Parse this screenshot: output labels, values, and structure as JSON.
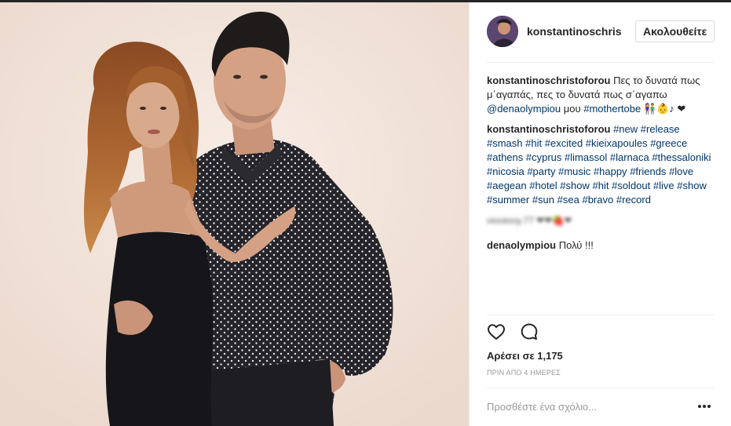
{
  "post": {
    "author": "konstantinoschristoforou",
    "author_short": "konstantinoschristo",
    "follow_label": "Ακολουθείτε"
  },
  "comments": [
    {
      "author": "konstantinoschristoforou",
      "text_before": " Πες το δυνατά πως μ΄αγαπάς, πες το δυνατά πως σ΄αγαπω ",
      "mention": "@denaolympiou",
      "text_mid": " μου ",
      "hashtag": "#mothertobe",
      "emoji": " 👫👶♪ ❤"
    },
    {
      "author": "konstantinoschristoforou",
      "hashtags": [
        "#new",
        "#release",
        "#smash",
        "#hit",
        "#excited",
        "#kieixapoules",
        "#greece",
        "#athens",
        "#cyprus",
        "#limassol",
        "#larnaca",
        "#thessaloniki",
        "#nicosia",
        "#party",
        "#music",
        "#happy",
        "#friends",
        "#love",
        "#aegean",
        "#hotel",
        "#show",
        "#hit",
        "#soldout",
        "#live",
        "#show",
        "#summer",
        "#sun",
        "#sea",
        "#bravo",
        "#record"
      ]
    },
    {
      "author": "viooiooy.77 ❤❤🍓❤",
      "text": ""
    },
    {
      "author": "denaolympiou",
      "text": " Πολύ !!!"
    }
  ],
  "actions": {
    "like_icon": "heart-icon",
    "comment_icon": "comment-icon"
  },
  "likes_text": "Αρέσει σε 1,175",
  "timestamp": "ΠΡΙΝ ΑΠΟ 4 ΗΜΕΡΕΣ",
  "add_comment_placeholder": "Προσθέστε ένα σχόλιο...",
  "more_icon": "more-options-icon",
  "colors": {
    "link": "#003569",
    "text": "#262626",
    "muted": "#999999",
    "border": "#efefef",
    "photo_background": "#f1e3da"
  }
}
